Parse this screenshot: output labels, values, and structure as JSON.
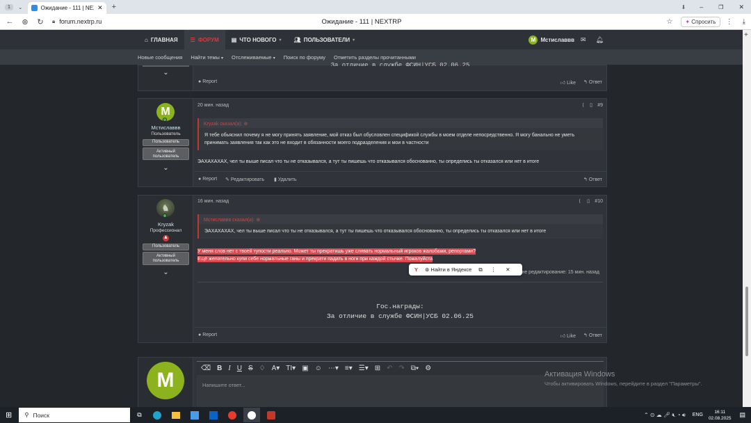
{
  "browser": {
    "tab_count": "1",
    "tab_title": "Ожидание - 111 | NEXT",
    "url": "forum.nextrp.ru",
    "page_title": "Ожидание - 111 | NEXTRP",
    "ask_label": "Спросить"
  },
  "nav": {
    "items": [
      {
        "label": "ГЛАВНАЯ",
        "icon": "home-icon"
      },
      {
        "label": "ФОРУМ",
        "icon": "forum-icon"
      },
      {
        "label": "ЧТО НОВОГО",
        "icon": "news-icon"
      },
      {
        "label": "ПОЛЬЗОВАТЕЛИ",
        "icon": "users-icon"
      }
    ],
    "user": "Мстиславвв",
    "user_initial": "M",
    "accent": "#d33b3b"
  },
  "subnav": [
    "Новые сообщения",
    "Найти темы",
    "Отслеживаемые",
    "Поиск по форуму",
    "Отметить разделы прочитанными"
  ],
  "post_top": {
    "cut_text": "За отличие в службе ФСИН|УСБ 02.06.25",
    "report": "Report",
    "like": "Like",
    "reply": "Ответ"
  },
  "post9": {
    "initial": "M",
    "name": "Мстиславвв",
    "title": "Пользователь",
    "badges": [
      "Пользователь",
      "Активный пользователь"
    ],
    "time": "20 мин. назад",
    "num": "#9",
    "quote_author": "Kryzak сказал(а):",
    "quote_text": "Я тебе обьяснил почему я не могу принять заявление, мой отказ был обусловлен спецификой службы в моем отделе непосредственно. Я могу банально не уметь принимать заявления так как это не входит в обязанности моего подразделения и мои в частности",
    "text": "ЭАХАХАХАХ, чел ты выше писал что ты не отказывался, а тут ты пишешь что отказывался обоснованно, ты определись ты отказался или нет в итоге",
    "report": "Report",
    "edit": "Редактировать",
    "delete": "Удалить",
    "reply": "Ответ"
  },
  "post10": {
    "name": "Kryzak",
    "title": "Профессионал",
    "badges": [
      "Пользователь",
      "Активный пользователь"
    ],
    "time": "16 мин. назад",
    "num": "#10",
    "quote_author": "Мстиславвв сказал(а):",
    "quote_text": "ЭАХАХАХАХ, чел ты выше писал что ты не отказывался, а тут ты пишешь что отказывался обоснованно, ты определись ты отказался или нет в итоге",
    "text1": "У меня слов нет с твоей тупости реально. Может ты прекратишь уже сливать нормальный игроков жалобами, репортами?",
    "text2": "Ещё желательно купи себе нормальные ганы и прекрати падать в ноги при каждой стычке. Пожалуйста",
    "edited": "не редактирование: 15 мин. назад",
    "sig1": "Гос.награды:",
    "sig2": "За отличие в службе ФСИН|УСБ 02.06.25",
    "report": "Report",
    "like": "Like",
    "reply": "Ответ"
  },
  "popup": {
    "label": "Найти в Яндексе"
  },
  "reply_box": {
    "initial": "M",
    "placeholder": "Напишите ответ..."
  },
  "watermark": {
    "line1": "Активация Windows",
    "line2": "Чтобы активировать Windows, перейдите в раздел \"Параметры\"."
  },
  "taskbar": {
    "search": "Поиск",
    "lang": "ENG",
    "time": "16:11",
    "date": "02.08.2025"
  }
}
